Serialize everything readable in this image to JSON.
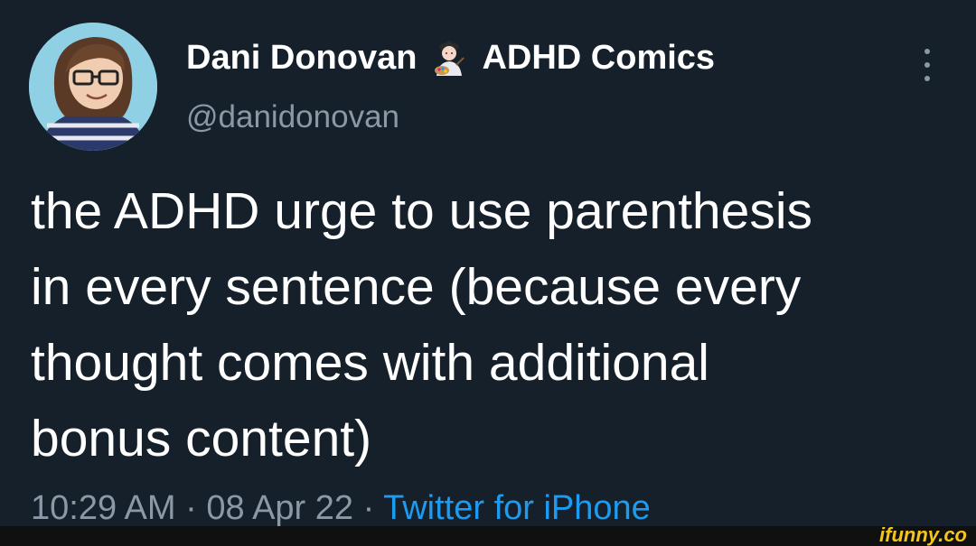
{
  "author": {
    "display_name": "Dani Donovan",
    "badge_text": "ADHD Comics",
    "handle": "@danidonovan",
    "avatar_icon": "cartoon-avatar-icon",
    "badge_icon": "artist-emoji-icon"
  },
  "tweet": {
    "lines": [
      "the ADHD urge to use parenthesis",
      "in every sentence (because every",
      "thought comes with additional",
      "bonus content)"
    ],
    "time": "10:29 AM",
    "separator": "·",
    "date": "08 Apr 22",
    "source": "Twitter for iPhone"
  },
  "watermark": {
    "text": "ifunny.co"
  },
  "colors": {
    "background": "#15202b",
    "text": "#ffffff",
    "secondary": "#8b98a5",
    "link": "#1d9bf0",
    "watermark": "#f5c518"
  }
}
